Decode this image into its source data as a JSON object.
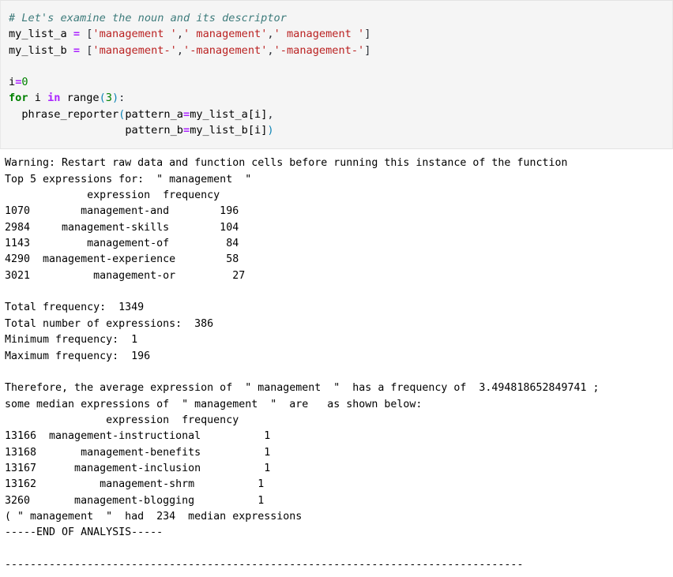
{
  "code_cell": {
    "comment_line": "# Let's examine the noun and its descriptor",
    "var_a_name": "my_list_a",
    "var_b_name": "my_list_b",
    "assign_op": " = ",
    "open_bracket": "[",
    "close_bracket": "]",
    "comma": ",",
    "list_a_items": [
      "'management '",
      "' management'",
      "' management '"
    ],
    "list_b_items": [
      "'management-'",
      "'-management'",
      "'-management-'"
    ],
    "blank_line": "",
    "init_line_name": "i",
    "init_line_op": "=",
    "init_line_value": "0",
    "for_keyword": "for",
    "for_var": " i ",
    "in_keyword": "in",
    "range_call_name": " range",
    "range_open": "(",
    "range_arg": "3",
    "range_close": ")",
    "for_colon": ":",
    "call_indent": "  ",
    "call_name": "phrase_reporter",
    "call_open": "(",
    "arg1_name": "pattern_a",
    "arg1_op": "=",
    "arg1_value": "my_list_a[i]",
    "arg1_comma": ",",
    "arg2_indent": "                  ",
    "arg2_name": "pattern_b",
    "arg2_op": "=",
    "arg2_value": "my_list_b[i]",
    "call_close": ")"
  },
  "output": {
    "warning_line": "Warning: Restart raw data and function cells before running this instance of the function",
    "top5_header_line": "Top 5 expressions for:  \" management  \"",
    "top5_table": {
      "header": "             expression  frequency",
      "rows": [
        "1070        management-and        196",
        "2984     management-skills        104",
        "1143         management-of         84",
        "4290  management-experience        58",
        "3021          management-or         27"
      ],
      "index_values": [
        "1070",
        "2984",
        "1143",
        "4290",
        "3021"
      ],
      "expression_values": [
        "management-and",
        "management-skills",
        "management-of",
        "management-experience",
        "management-or"
      ],
      "frequency_values": [
        "196",
        "104",
        "84",
        "58",
        "27"
      ],
      "column_headers": [
        "expression",
        "frequency"
      ]
    },
    "stats": {
      "total_frequency_label": "Total frequency:",
      "total_frequency_value": "1349",
      "total_expressions_label": "Total number of expressions:",
      "total_expressions_value": "386",
      "minimum_frequency_label": "Minimum frequency:",
      "minimum_frequency_value": "1",
      "maximum_frequency_label": "Maximum frequency:",
      "maximum_frequency_value": "196",
      "lines": [
        "Total frequency:  1349",
        "Total number of expressions:  386",
        "Minimum frequency:  1",
        "Maximum frequency:  196"
      ]
    },
    "therefore_line_1": "Therefore, the average expression of  \" management  \"  has a frequency of  3.494818652849741 ;",
    "therefore_line_2": "some median expressions of  \" management  \"  are   as shown below:",
    "average_frequency": "3.494818652849741",
    "median_table": {
      "header": "                expression  frequency",
      "rows": [
        "13166  management-instructional          1",
        "13168       management-benefits          1",
        "13167      management-inclusion          1",
        "13162          management-shrm          1",
        "3260       management-blogging          1"
      ],
      "index_values": [
        "13166",
        "13168",
        "13167",
        "13162",
        "3260"
      ],
      "expression_values": [
        "management-instructional",
        "management-benefits",
        "management-inclusion",
        "management-shrm",
        "management-blogging"
      ],
      "frequency_values": [
        "1",
        "1",
        "1",
        "1",
        "1"
      ],
      "column_headers": [
        "expression",
        "frequency"
      ]
    },
    "median_count_line": "( \" management  \"  had  234  median expressions",
    "median_count_value": "234",
    "end_of_analysis_line": "-----END OF ANALYSIS-----",
    "separator_line": "----------------------------------------------------------------------------------"
  },
  "colors": {
    "code_cell_background": "#f5f5f5",
    "code_cell_border": "#e3e3e3",
    "comment": "#3D7B7B",
    "string": "#BA2121",
    "keyword": "#008000",
    "operator": "#AA22FF",
    "number": "#008000",
    "punctuation": "#0e84b5",
    "text": "#000000",
    "page_background": "#ffffff"
  }
}
